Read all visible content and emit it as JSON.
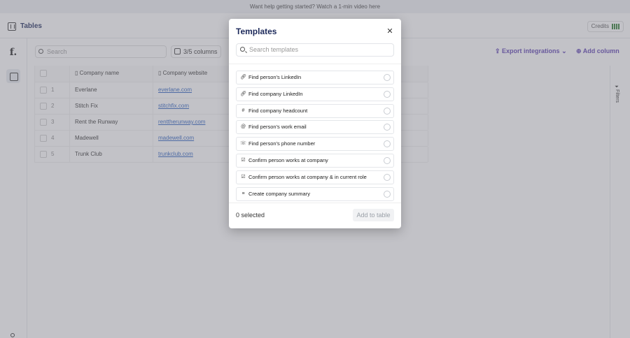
{
  "banner": {
    "text": "Want help getting started? Watch a 1-min video here"
  },
  "header": {
    "title": "Tables",
    "credits_label": "Credits"
  },
  "sidebar": {
    "logo": "f."
  },
  "toolbar": {
    "search_placeholder": "Search",
    "columns_label": "3/5 columns",
    "export_label": "Export integrations",
    "add_column_label": "Add column"
  },
  "table": {
    "headers": [
      "Company name",
      "Company website"
    ],
    "rows": [
      {
        "num": "1",
        "name": "Everlane",
        "website": "everlane.com"
      },
      {
        "num": "2",
        "name": "Stitch Fix",
        "website": "stitchfix.com"
      },
      {
        "num": "3",
        "name": "Rent the Runway",
        "website": "renttherunway.com"
      },
      {
        "num": "4",
        "name": "Madewell",
        "website": "madewell.com"
      },
      {
        "num": "5",
        "name": "Trunk Club",
        "website": "trunkclub.com"
      }
    ]
  },
  "filters_label": "Filters",
  "modal": {
    "title": "Templates",
    "search_placeholder": "Search templates",
    "items": [
      {
        "label": "Find person's LinkedIn",
        "icon": "link-icon"
      },
      {
        "label": "Find company LinkedIn",
        "icon": "link-icon"
      },
      {
        "label": "Find company headcount",
        "icon": "hash-icon"
      },
      {
        "label": "Find person's work email",
        "icon": "at-icon"
      },
      {
        "label": "Find person's phone number",
        "icon": "phone-icon"
      },
      {
        "label": "Confirm person works at company",
        "icon": "checkbox-icon"
      },
      {
        "label": "Confirm person works at company & in current role",
        "icon": "checkbox-icon"
      },
      {
        "label": "Create company summary",
        "icon": "lines-icon"
      }
    ],
    "selected_label": "0 selected",
    "add_button_label": "Add to table"
  }
}
